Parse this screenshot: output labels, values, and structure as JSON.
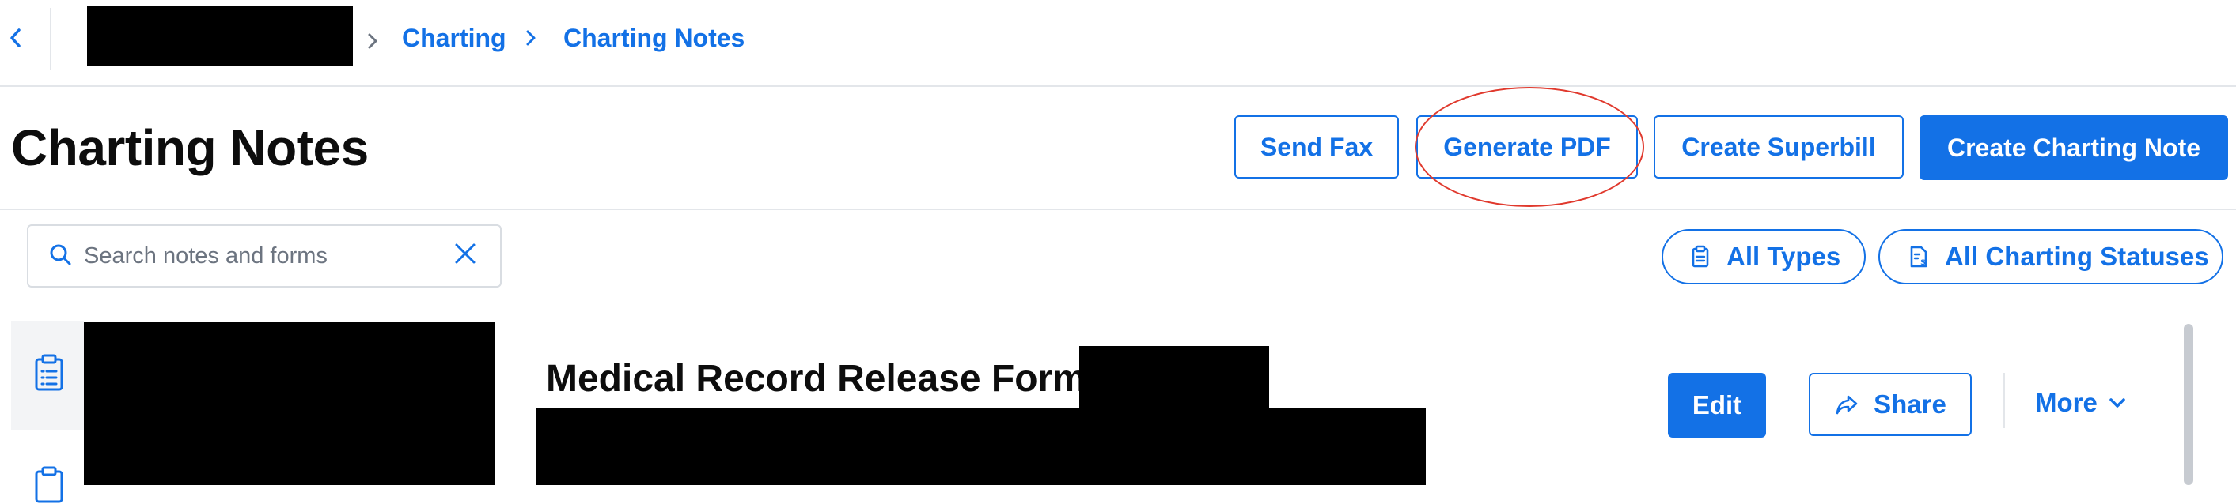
{
  "breadcrumb": {
    "items": [
      {
        "label": "Charting"
      },
      {
        "label": "Charting Notes"
      }
    ]
  },
  "header": {
    "title": "Charting Notes",
    "actions": {
      "send_fax": "Send Fax",
      "generate_pdf": "Generate PDF",
      "create_superbill": "Create Superbill",
      "create_charting_note": "Create Charting Note"
    }
  },
  "search": {
    "value": "",
    "placeholder": "Search notes and forms"
  },
  "filters": {
    "types": "All Types",
    "statuses": "All Charting Statuses"
  },
  "notes": [
    {
      "title": "Medical Record Release Form",
      "actions": {
        "edit": "Edit",
        "share": "Share",
        "more": "More"
      }
    }
  ],
  "icons": {
    "back": "chevron-left-icon",
    "search": "search-icon",
    "clear": "close-icon",
    "types": "clipboard-icon",
    "statuses": "document-dollar-icon",
    "note": "clipboard-list-icon",
    "share": "share-arrow-icon",
    "more": "chevron-down-icon"
  },
  "colors": {
    "accent": "#1371e6",
    "annotation": "#e0392d",
    "divider": "#e3e6ea",
    "redaction": "#000000"
  }
}
